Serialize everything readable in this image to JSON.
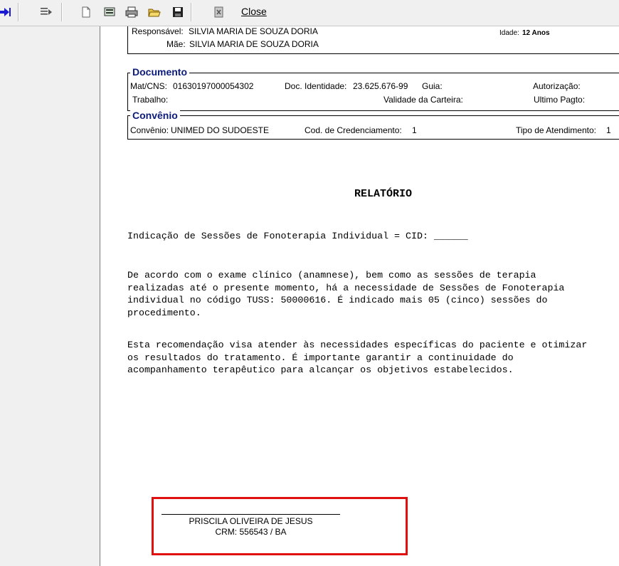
{
  "toolbar": {
    "close_label": "Close",
    "icons": [
      "arrow-right-icon",
      "list-icon",
      "new-page-icon",
      "print-setup-icon",
      "print-icon",
      "open-folder-icon",
      "save-icon",
      "export-icon"
    ]
  },
  "patient": {
    "responsavel_label": "Responsável:",
    "responsavel_value": "SILVIA MARIA DE SOUZA DORIA",
    "mae_label": "Mãe:",
    "mae_value": "SILVIA MARIA DE SOUZA DORIA",
    "idade_label": "Idade:",
    "idade_value": "12 Anos"
  },
  "documento": {
    "title": "Documento",
    "mat_cns_label": "Mat/CNS:",
    "mat_cns_value": "01630197000054302",
    "doc_identidade_label": "Doc. Identidade:",
    "doc_identidade_value": "23.625.676-99",
    "guia_label": "Guia:",
    "autorizacao_label": "Autorização:",
    "trabalho_label": "Trabalho:",
    "validade_label": "Validade da Carteira:",
    "ultimo_pagto_label": "Ultimo Pagto:"
  },
  "convenio": {
    "title": "Convênio",
    "convenio_label": "Convênio:",
    "convenio_value": "UNIMED DO SUDOESTE",
    "cod_label": "Cod. de Credenciamento:",
    "cod_value": "1",
    "tipo_label": "Tipo de Atendimento:",
    "tipo_value": "1"
  },
  "report": {
    "title": "RELATÓRIO",
    "indicacao": "Indicação de Sessões de Fonoterapia Individual = CID: ______",
    "paragraph1_lines": [
      "De acordo com o exame clínico (anamnese), bem como as sessões de terapia",
      "realizadas até o presente momento, há a necessidade de Sessões de Fonoterapia",
      "individual no código TUSS: 50000616. É indicado mais 05 (cinco) sessões do",
      "procedimento."
    ],
    "paragraph2_lines": [
      "Esta recomendação visa atender às necessidades específicas do paciente e otimizar",
      "os resultados do tratamento. É importante garantir a continuidade do",
      "acompanhamento terapêutico para alcançar os objetivos estabelecidos."
    ]
  },
  "signature": {
    "name": "PRISCILA OLIVEIRA DE JESUS",
    "crm": "CRM: 556543 / BA",
    "highlight_color": "#e01010"
  }
}
